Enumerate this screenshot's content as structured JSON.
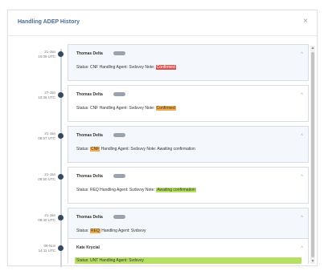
{
  "modal": {
    "title": "Handling ADEP History",
    "close_glyph": "×"
  },
  "entries": [
    {
      "time_line1": "21-Jan",
      "time_line2": "10:09 UTC",
      "author": "Thomas Delta",
      "status_prefix": "Status: CNF Handling Agent: Svdsvvy Note:",
      "highlight": "Confirmed",
      "highlight_color": "#d9534f"
    },
    {
      "time_line1": "27-Jan",
      "time_line2": "10:36 UTC",
      "author": "Thomas Delta",
      "status_prefix": "Status: CNF Handling Agent: Svdsvvy Note:",
      "highlight": "Confirmed",
      "highlight_color": "#f0ad4e"
    },
    {
      "time_line1": "21-Jan",
      "time_line2": "09:57 UTC",
      "author": "Thomas Delta",
      "status_lead": "Status:",
      "status_code": "CNF",
      "status_rest": "Handling Agent: Svdsvvy Note: Awaiting confirmation",
      "highlight_color": "#f0ad4e"
    },
    {
      "time_line1": "21-Jan",
      "time_line2": "09:50 UTC",
      "author": "Thomas Delta",
      "status_prefix": "Status: REQ Handling Agent: Svdsvvy Note:",
      "highlight": "Awaiting confirmation",
      "highlight_color": "#b6e062"
    },
    {
      "time_line1": "21-Jan",
      "time_line2": "09:40 UTC",
      "author": "Thomas Delta",
      "status_lead": "Status:",
      "status_code": "REQ",
      "status_rest": "Handling Agent: Svdsvvy",
      "highlight_color": "#f0ad4e"
    },
    {
      "time_line1": "08-Nov",
      "time_line2": "14:11 UTC",
      "author": "Kate Krycial",
      "status_full": "Status: UNT Handling Agent: Svdsvvy",
      "highlight_color": "#b6e062"
    }
  ],
  "icons": {
    "close": "close-icon",
    "timeline_dot": "timeline-dot-icon",
    "chevron": "chevron-up-icon",
    "user_tag": "user-tag-pill",
    "chevron_glyph": "^",
    "scroll_up_glyph": "▲",
    "scroll_down_glyph": "▼"
  },
  "colors": {
    "title": "#4a6d9c",
    "red_badge": "#d9534f",
    "orange_badge": "#f0ad4e",
    "green_badge": "#b6e062"
  }
}
